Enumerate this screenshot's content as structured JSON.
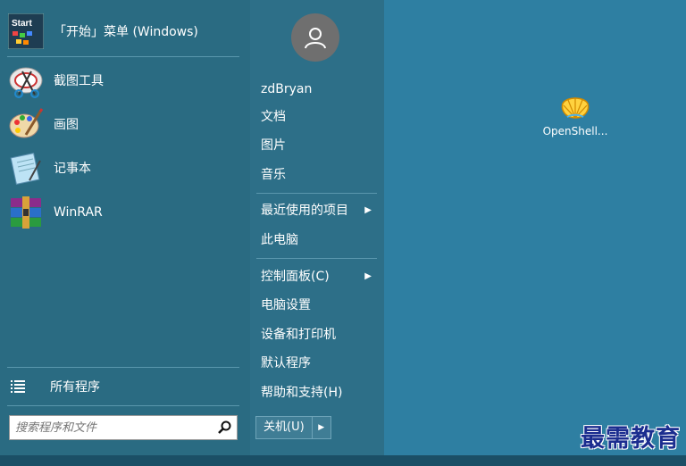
{
  "start_menu": {
    "pinned": [
      {
        "label": "「开始」菜单 (Windows)",
        "icon": "start-menu-icon",
        "icon_text": "Start"
      },
      {
        "label": "截图工具",
        "icon": "snipping-tool-icon"
      },
      {
        "label": "画图",
        "icon": "paint-icon"
      },
      {
        "label": "记事本",
        "icon": "notepad-icon"
      },
      {
        "label": "WinRAR",
        "icon": "winrar-icon"
      }
    ],
    "all_programs": "所有程序",
    "search_placeholder": "搜索程序和文件",
    "user": "zdBryan",
    "right_items": [
      {
        "label": "文档"
      },
      {
        "label": "图片"
      },
      {
        "label": "音乐"
      },
      {
        "label": "最近使用的项目",
        "submenu": true
      },
      {
        "label": "此电脑"
      },
      {
        "label": "控制面板(C)",
        "submenu": true
      },
      {
        "label": "电脑设置"
      },
      {
        "label": "设备和打印机"
      },
      {
        "label": "默认程序"
      },
      {
        "label": "帮助和支持(H)"
      }
    ],
    "shutdown_label": "关机(U)"
  },
  "desktop": {
    "icon_label": "OpenShell..."
  },
  "watermark": "最需教育",
  "colors": {
    "desktop": "#2e7fa2",
    "menu_left": "#2a6b82",
    "menu_right": "#2d6f88",
    "watermark": "#1b2d8f"
  }
}
